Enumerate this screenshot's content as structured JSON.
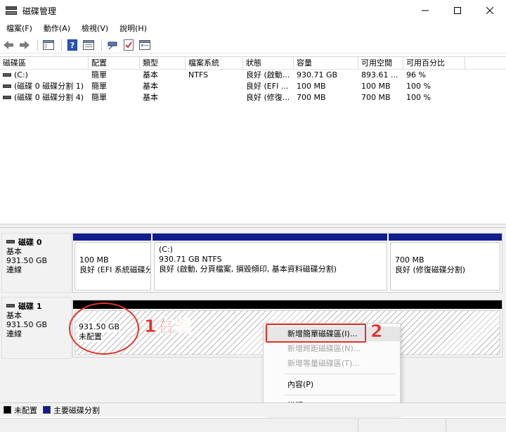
{
  "window": {
    "title": "磁碟管理"
  },
  "menu": [
    "檔案(F)",
    "動作(A)",
    "檢視(V)",
    "說明(H)"
  ],
  "volume_table": {
    "headers": [
      "磁碟區",
      "配置",
      "類型",
      "檔案系統",
      "狀態",
      "容量",
      "可用空間",
      "可用百分比",
      ""
    ],
    "rows": [
      [
        "(C:)",
        "簡單",
        "基本",
        "NTFS",
        "良好 (啟動...",
        "930.71 GB",
        "893.61 ...",
        "96 %"
      ],
      [
        "(磁碟 0 磁碟分割 1)",
        "簡單",
        "基本",
        "",
        "良好 (EFI ...",
        "100 MB",
        "100 MB",
        "100 %"
      ],
      [
        "(磁碟 0 磁碟分割 4)",
        "簡單",
        "基本",
        "",
        "良好 (修復...",
        "700 MB",
        "700 MB",
        "100 %"
      ]
    ]
  },
  "disks": [
    {
      "name": "磁碟 0",
      "type": "基本",
      "size": "931.50 GB",
      "status": "連線",
      "partitions": [
        {
          "line1": "",
          "line2": "100 MB",
          "line3": "良好 (EFI 系統磁碟分割)"
        },
        {
          "line1": "(C:)",
          "line2": "930.71 GB NTFS",
          "line3": "良好 (啟動, 分頁檔案, 損毀傾印, 基本資料磁碟分割)"
        },
        {
          "line1": "",
          "line2": "700 MB",
          "line3": "良好 (修復磁碟分割)"
        }
      ]
    },
    {
      "name": "磁碟 1",
      "type": "基本",
      "size": "931.50 GB",
      "status": "連線",
      "unallocated": {
        "size": "931.50 GB",
        "label": "未配置"
      }
    }
  ],
  "annotations": {
    "step1": "1右鍵",
    "step2": "2"
  },
  "context_menu": [
    {
      "label": "新增簡單磁碟區(I)...",
      "enabled": true
    },
    {
      "label": "新增跨距磁碟區(N)...",
      "enabled": false
    },
    {
      "label": "新增等量磁碟區(T)...",
      "enabled": false
    },
    {
      "label": "內容(P)",
      "enabled": true
    },
    {
      "label": "說明(H)",
      "enabled": true
    }
  ],
  "legend": [
    {
      "label": "未配置",
      "color": "#000000"
    },
    {
      "label": "主要磁碟分割",
      "color": "#0f1d8f"
    }
  ],
  "icons": [
    "back-arrow-icon",
    "forward-arrow-icon",
    "console-tree-icon",
    "help-icon",
    "properties-icon",
    "connect-icon",
    "check-icon",
    "list-icon"
  ]
}
